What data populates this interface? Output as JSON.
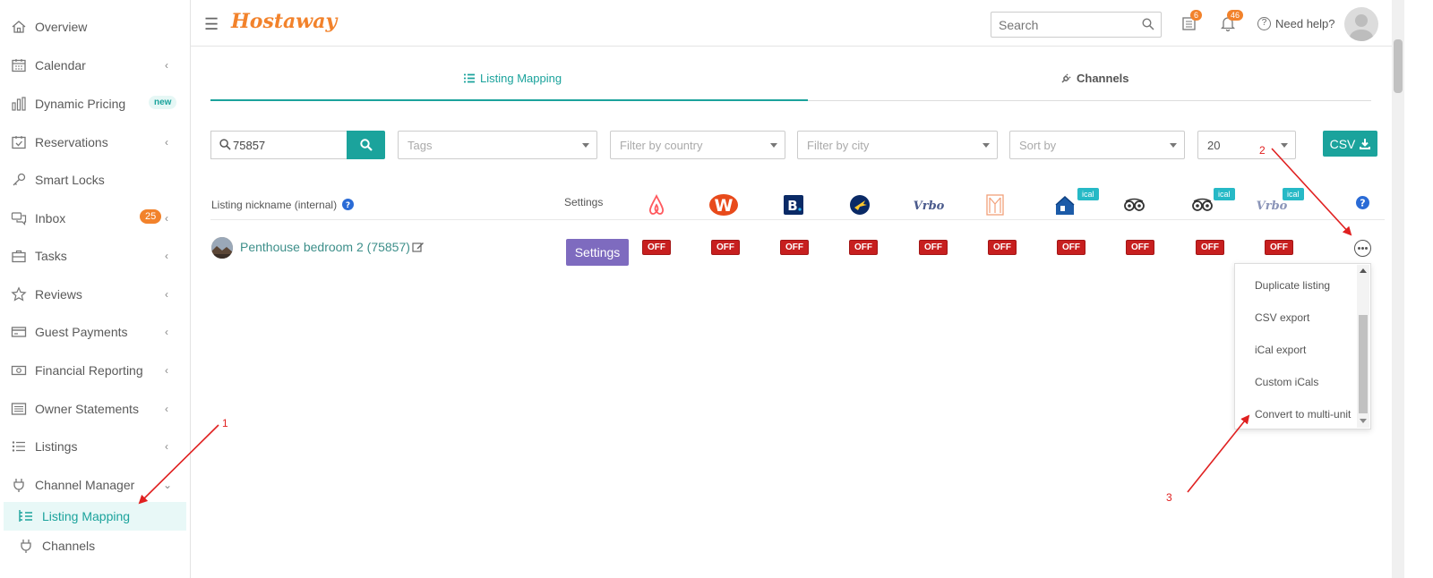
{
  "brand": {
    "name": "Hostaway",
    "accent": "#1ba39c",
    "orange": "#f2822b"
  },
  "sidebar": {
    "items": [
      {
        "label": "Overview",
        "icon": "home-icon"
      },
      {
        "label": "Calendar",
        "icon": "calendar-icon"
      },
      {
        "label": "Dynamic Pricing",
        "icon": "bar-chart-icon",
        "badge": "new"
      },
      {
        "label": "Reservations",
        "icon": "calendar-check-icon"
      },
      {
        "label": "Smart Locks",
        "icon": "key-icon"
      },
      {
        "label": "Inbox",
        "icon": "chat-icon",
        "badge": "25"
      },
      {
        "label": "Tasks",
        "icon": "briefcase-icon"
      },
      {
        "label": "Reviews",
        "icon": "star-icon"
      },
      {
        "label": "Guest Payments",
        "icon": "credit-card-icon"
      },
      {
        "label": "Financial Reporting",
        "icon": "money-icon"
      },
      {
        "label": "Owner Statements",
        "icon": "list-box-icon"
      },
      {
        "label": "Listings",
        "icon": "list-icon"
      },
      {
        "label": "Channel Manager",
        "icon": "plug-icon"
      }
    ],
    "sub_items": [
      {
        "label": "Listing Mapping",
        "icon": "listing-mapping-icon",
        "active": true
      },
      {
        "label": "Channels",
        "icon": "plug-icon"
      }
    ]
  },
  "topbar": {
    "search_placeholder": "Search",
    "calendar_badge": "6",
    "notification_badge": "46",
    "help_label": "Need help?"
  },
  "tabs": [
    {
      "label": "Listing Mapping",
      "active": true
    },
    {
      "label": "Channels",
      "active": false
    }
  ],
  "filters": {
    "search_value": "75857",
    "tags_placeholder": "Tags",
    "country_placeholder": "Filter by country",
    "city_placeholder": "Filter by city",
    "sort_placeholder": "Sort by",
    "page_size": "20",
    "csv_label": "CSV"
  },
  "table": {
    "nickname_header": "Listing nickname (internal)",
    "settings_header": "Settings",
    "channels": [
      {
        "name": "airbnb-icon"
      },
      {
        "name": "w-icon"
      },
      {
        "name": "booking-icon"
      },
      {
        "name": "expedia-icon"
      },
      {
        "name": "vrbo-icon"
      },
      {
        "name": "m-icon"
      },
      {
        "name": "homeaway-icon",
        "badge": "ical"
      },
      {
        "name": "tripadvisor-icon"
      },
      {
        "name": "tripadvisor-icon",
        "badge": "ical"
      },
      {
        "name": "vrbo-icon",
        "badge": "ical"
      }
    ],
    "rows": [
      {
        "name": "Penthouse bedroom 2 (75857)",
        "settings_label": "Settings",
        "statuses": [
          "OFF",
          "OFF",
          "OFF",
          "OFF",
          "OFF",
          "OFF",
          "OFF",
          "OFF",
          "OFF",
          "OFF"
        ]
      }
    ]
  },
  "more_menu": {
    "items": [
      "Duplicate listing",
      "CSV export",
      "iCal export",
      "Custom iCals",
      "Convert to multi-unit"
    ]
  },
  "annotations": [
    "1",
    "2",
    "3"
  ]
}
